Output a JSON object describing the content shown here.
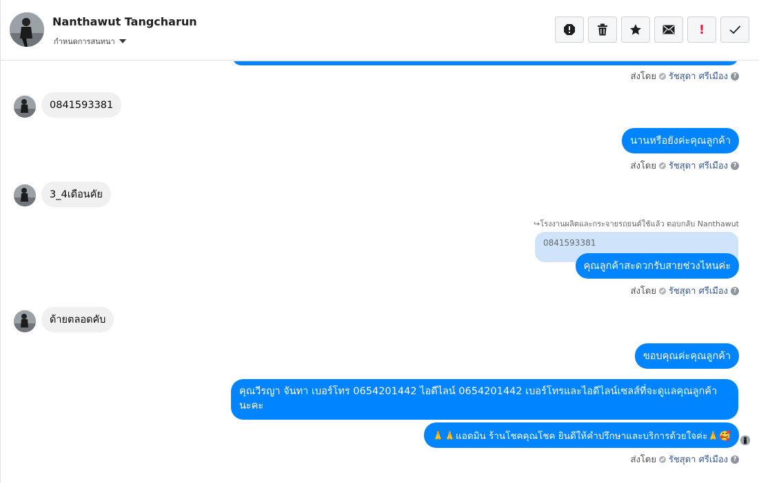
{
  "header": {
    "contact_name": "Nanthawut Tangcharun",
    "assign_label": "กำหนดการสนทนา",
    "actions": [
      "spam-icon",
      "trash-icon",
      "star-icon",
      "envelope-icon",
      "important-icon",
      "check-icon"
    ],
    "important_glyph": "!"
  },
  "sent_by": {
    "prefix": "ส่งโดย",
    "agent": "รัชสุดา ศรีเมือง",
    "help": "?"
  },
  "messages": {
    "in_1": "0841593381",
    "out_1": "นานหรือยังค่ะคุณลูกค้า",
    "in_2": "3_4เดือนคัย",
    "reply_hint": "↪โรงงานผลิตและกระจายรถยนต์ใช้แล้ว ตอบกลับ Nanthawut",
    "quoted": "0841593381",
    "out_2": "คุณลูกค้าสะดวกรับสายช่วงไหนค่ะ",
    "in_3": "ด้ายตลอดคับ",
    "out_3": "ขอบคุณค่ะคุณลูกค้า",
    "out_4": "คุณวีรญา จันทา      เบอร์โทร 0654201442  ไอดีไลน์ 0654201442   เบอร์โทรและไอดีไลน์เซลส์ที่จะดูแลคุณลูกค้านะคะ",
    "out_5": "🙏🙏แอดมิน ร้านโชคคุณโชค ยินดีให้คำปรึกษาและบริการด้วยใจค่ะ🙏🥰"
  },
  "colors": {
    "outgoing": "#0084ff",
    "incoming": "#f0f0f0",
    "quoted": "#cfe4fb"
  }
}
